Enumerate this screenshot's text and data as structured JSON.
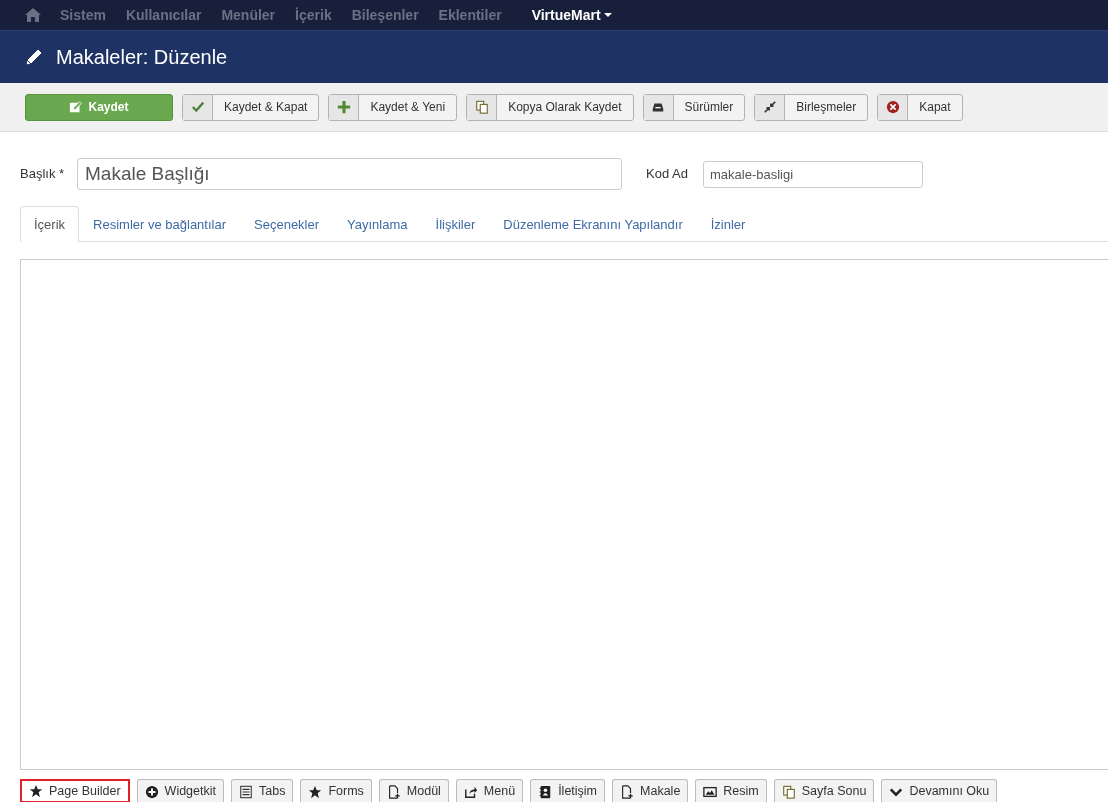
{
  "menu": {
    "items": [
      {
        "label": "Sistem"
      },
      {
        "label": "Kullanıcılar"
      },
      {
        "label": "Menüler"
      },
      {
        "label": "İçerik"
      },
      {
        "label": "Bileşenler"
      },
      {
        "label": "Eklentiler"
      }
    ],
    "extra": {
      "label": "VirtueMart"
    }
  },
  "header": {
    "title": "Makaleler: Düzenle"
  },
  "toolbar": [
    {
      "label": "Kaydet",
      "kind": "primary"
    },
    {
      "label": "Kaydet & Kapat",
      "kind": "split"
    },
    {
      "label": "Kaydet & Yeni",
      "kind": "split"
    },
    {
      "label": "Kopya Olarak Kaydet",
      "kind": "split"
    },
    {
      "label": "Sürümler",
      "kind": "split"
    },
    {
      "label": "Birleşmeler",
      "kind": "split"
    },
    {
      "label": "Kapat",
      "kind": "split"
    }
  ],
  "form": {
    "title_label": "Başlık *",
    "title_value": "Makale Başlığı",
    "alias_label": "Kod Ad",
    "alias_value": "makale-basligi"
  },
  "tabs": [
    {
      "label": "İçerik",
      "selected": true
    },
    {
      "label": "Resimler ve bağlantılar",
      "selected": false
    },
    {
      "label": "Seçenekler",
      "selected": false
    },
    {
      "label": "Yayınlama",
      "selected": false
    },
    {
      "label": "İlişkiler",
      "selected": false
    },
    {
      "label": "Düzenleme Ekranını Yapılandır",
      "selected": false
    },
    {
      "label": "İzinler",
      "selected": false
    }
  ],
  "editor_buttons": [
    {
      "label": "Page Builder",
      "highlighted": true
    },
    {
      "label": "Widgetkit",
      "highlighted": false
    },
    {
      "label": "Tabs",
      "highlighted": false
    },
    {
      "label": "Forms",
      "highlighted": false
    },
    {
      "label": "Modül",
      "highlighted": false
    },
    {
      "label": "Menü",
      "highlighted": false
    },
    {
      "label": "İletişim",
      "highlighted": false
    },
    {
      "label": "Makale",
      "highlighted": false
    },
    {
      "label": "Resim",
      "highlighted": false
    },
    {
      "label": "Sayfa Sonu",
      "highlighted": false
    },
    {
      "label": "Devamını Oku",
      "highlighted": false
    }
  ]
}
